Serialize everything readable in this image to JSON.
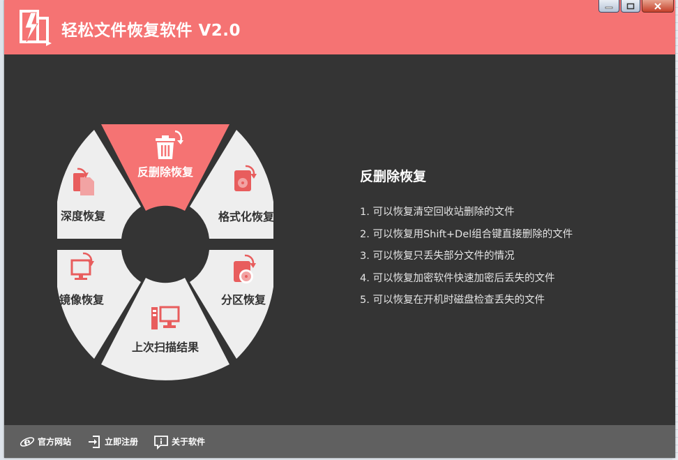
{
  "app": {
    "title": "轻松文件恢复软件 V2.0"
  },
  "wheel": {
    "segments": [
      {
        "id": "undelete",
        "label": "反删除恢复",
        "icon": "trash-restore-icon",
        "active": true
      },
      {
        "id": "format",
        "label": "格式化恢复",
        "icon": "disk-restore-icon",
        "active": false
      },
      {
        "id": "partition",
        "label": "分区恢复",
        "icon": "partition-restore-icon",
        "active": false
      },
      {
        "id": "last-scan",
        "label": "上次扫描结果",
        "icon": "computer-icon",
        "active": false
      },
      {
        "id": "image",
        "label": "镜像恢复",
        "icon": "monitor-restore-icon",
        "active": false
      },
      {
        "id": "deep",
        "label": "深度恢复",
        "icon": "file-restore-icon",
        "active": false
      }
    ]
  },
  "info": {
    "title": "反删除恢复",
    "items": [
      "1. 可以恢复清空回收站删除的文件",
      "2. 可以恢复用Shift+Del组合键直接删除的文件",
      "3. 可以恢复只丢失部分文件的情况",
      "4. 可以恢复加密软件快速加密后丢失的文件",
      "5. 可以恢复在开机时磁盘检查丢失的文件"
    ]
  },
  "footer": {
    "links": [
      {
        "label": "官方网站",
        "icon": "ie-icon"
      },
      {
        "label": "立即注册",
        "icon": "login-icon"
      },
      {
        "label": "关于软件",
        "icon": "info-icon"
      }
    ]
  },
  "colors": {
    "accent": "#f57373",
    "background": "#343434",
    "segment": "#eeeeee",
    "footer": "#606060"
  }
}
